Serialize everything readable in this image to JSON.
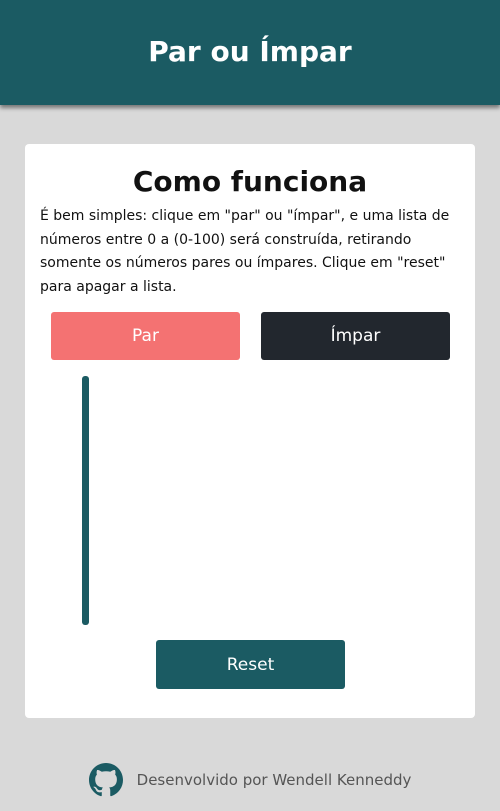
{
  "header": {
    "title": "Par ou Ímpar"
  },
  "card": {
    "title": "Como funciona",
    "description": "É bem simples: clique em \"par\" ou \"ímpar\", e uma lista de números entre 0 a (0-100) será construída, retirando somente os números pares ou ímpares. Clique em \"reset\" para apagar a lista."
  },
  "buttons": {
    "par_label": "Par",
    "impar_label": "Ímpar",
    "reset_label": "Reset"
  },
  "footer": {
    "text": "Desenvolvido por Wendell Kenneddy",
    "icon": "github-icon"
  },
  "colors": {
    "primary": "#1b5b63",
    "par": "#f47272",
    "impar": "#22272e",
    "background": "#d9d9d9"
  }
}
